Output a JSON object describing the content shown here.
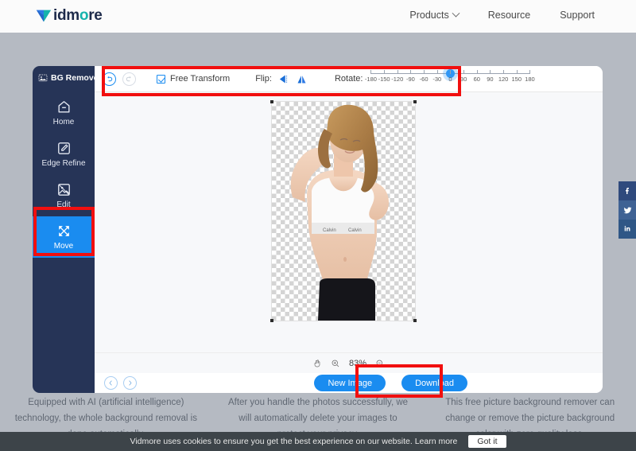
{
  "nav": {
    "logo": {
      "text_main": "idm",
      "text_teal": "o",
      "text_end": "re",
      "icon": "vidmore-v-logo"
    },
    "items": [
      {
        "label": "Products",
        "has_chevron": true
      },
      {
        "label": "Resource",
        "has_chevron": false
      },
      {
        "label": "Support",
        "has_chevron": false
      }
    ]
  },
  "social": [
    {
      "name": "facebook",
      "glyph": "f"
    },
    {
      "name": "twitter",
      "glyph": "ᴠ"
    },
    {
      "name": "linkedin",
      "glyph": "in"
    }
  ],
  "app": {
    "sidebar": {
      "title": "BG Remover",
      "title_icon": "image-icon",
      "items": [
        {
          "label": "Home",
          "icon": "home-icon",
          "active": false
        },
        {
          "label": "Edge Refine",
          "icon": "edge-refine-icon",
          "active": false
        },
        {
          "label": "Edit",
          "icon": "edit-image-icon",
          "active": false
        },
        {
          "label": "Move",
          "icon": "move-arrows-icon",
          "active": true
        }
      ]
    },
    "toolbar": {
      "undo_icon": "undo-icon",
      "redo_icon": "redo-icon",
      "free_transform_label": "Free Transform",
      "free_transform_checked": true,
      "flip_label": "Flip:",
      "flip_horizontal_icon": "flip-horizontal-icon",
      "flip_vertical_icon": "flip-vertical-icon",
      "rotate_label": "Rotate:",
      "rotate_value": 0,
      "rotate_min": -180,
      "rotate_max": 180,
      "rotate_ticks": [
        -180,
        -150,
        -120,
        -90,
        -60,
        -30,
        0,
        30,
        60,
        90,
        120,
        150,
        180
      ]
    },
    "canvas": {
      "transparent_background": true,
      "subject": "woman-with-removed-background"
    },
    "zoombar": {
      "pan_icon": "hand-icon",
      "zoom_in_icon": "zoom-in-icon",
      "zoom_level": "83%",
      "zoom_out_icon": "zoom-out-icon"
    },
    "bottombar": {
      "prev_icon": "chevron-left-icon",
      "next_icon": "chevron-right-icon",
      "new_image_label": "New Image",
      "download_label": "Download"
    }
  },
  "footer_columns": [
    "Equipped with AI (artificial intelligence) technology, the whole background removal is done automatically.",
    "After you handle the photos successfully, we will automatically delete your images to protect your privacy.",
    "This free picture background remover can change or remove the picture background color with zero quality loss."
  ],
  "cookie_bar": {
    "text": "Vidmore uses cookies to ensure you get the best experience on our website.",
    "learn_more": "Learn more",
    "button": "Got it"
  },
  "colors": {
    "accent_blue": "#1a8cf0",
    "sidebar_navy": "#263457",
    "annotation_red": "#f10f0f",
    "logo_teal": "#16b3ad"
  }
}
